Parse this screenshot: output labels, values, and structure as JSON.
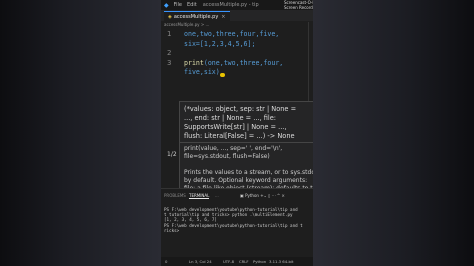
{
  "titlebar": {
    "menu": [
      "File",
      "Edit"
    ],
    "title": "accessMultiple.py - tip",
    "watermark_line1": "Screencast-O-Matic",
    "watermark_line2": "Screen Recorder"
  },
  "tab": {
    "label": "accessMultiple.py",
    "close": "×"
  },
  "breadcrumb": "accessMultiple.py > ...",
  "code": {
    "lines": [
      {
        "num": "1",
        "text": "one,two,three,four,five,"
      },
      {
        "num": "",
        "text": "six=[1,2,3,4,5,6];"
      },
      {
        "num": "2",
        "text": ""
      },
      {
        "num": "3",
        "fn": "print",
        "args": "(one,two,three,four,"
      },
      {
        "num": "",
        "text": "five,six)"
      }
    ]
  },
  "popup": {
    "signature": [
      "(*values: object, sep: str | None =",
      "..., end: str | None = ..., file:",
      "SupportsWrite[str] | None = ...,",
      "flush: Literal[False] = ...) -> None"
    ],
    "doc": [
      "print(value, ..., sep=' ', end='\\n',",
      "file=sys.stdout, flush=False)",
      "",
      "Prints the values to a stream, or to sys.stdout",
      "by default. Optional keyword arguments:",
      "file: a file-like object (stream); defaults to the"
    ],
    "pager": "1/2"
  },
  "panel": {
    "tabs": [
      "PROBLEMS",
      "TERMINAL",
      "..."
    ],
    "terminal_select": "Python",
    "terminal_lines": [
      "PS F:\\web development\\youtube\\python-tutorial\\tip and",
      "t tutorial\\tip and tricks> python .\\multiElement.py",
      "[1, 2, 3, 4, 5, 6, 7]",
      "PS F:\\web development\\youtube\\python-tutorial\\tip and t",
      "ricks> "
    ]
  },
  "status": {
    "items": [
      "0",
      "Ln 3, Col 24",
      "UTF-8",
      "CRLF",
      "Python",
      "3.11.3 64-bit"
    ]
  }
}
